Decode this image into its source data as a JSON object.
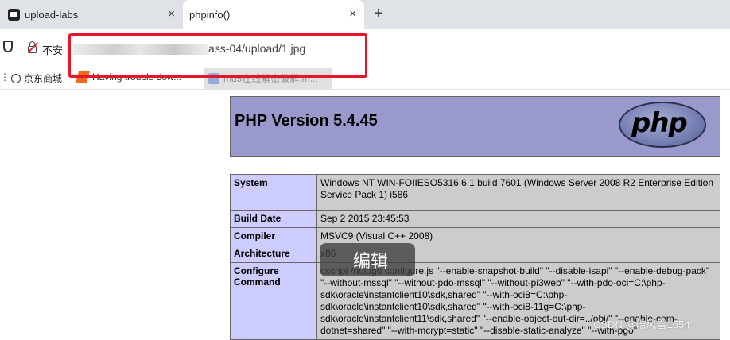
{
  "tabs": [
    {
      "label": "upload-labs",
      "icon": "page-icon",
      "close": "×"
    },
    {
      "label": "phpinfo()",
      "close": "×"
    }
  ],
  "new_tab": "+",
  "address_bar": {
    "security_label": "不安",
    "url_visible": "ass-04/upload/1.jpg"
  },
  "bookmarks": [
    {
      "label": "京东商城",
      "icon": "globe-icon"
    },
    {
      "label": "Having trouble dow...",
      "icon": "orange-favicon"
    },
    {
      "label": "md5在线解密破解,m...",
      "icon": "grid-favicon"
    }
  ],
  "bookmarks_overflow": "⋮",
  "php": {
    "version_title": "PHP Version 5.4.45",
    "logo_text": "php",
    "rows": [
      {
        "key": "System",
        "value": "Windows NT WIN-FOIIESO5316 6.1 build 7601 (Windows Server 2008 R2 Enterprise Edition Service Pack 1) i586"
      },
      {
        "key": "Build Date",
        "value": "Sep 2 2015 23:45:53"
      },
      {
        "key": "Compiler",
        "value": "MSVC9 (Visual C++ 2008)"
      },
      {
        "key": "Architecture",
        "value": "x86"
      },
      {
        "key": "Configure Command",
        "value": "cscript /nologo configure.js \"--enable-snapshot-build\" \"--disable-isapi\" \"--enable-debug-pack\" \"--without-mssql\" \"--without-pdo-mssql\" \"--without-pi3web\" \"--with-pdo-oci=C:\\php-sdk\\oracle\\instantclient10\\sdk,shared\" \"--with-oci8=C:\\php-sdk\\oracle\\instantclient10\\sdk,shared\" \"--with-oci8-11g=C:\\php-sdk\\oracle\\instantclient11\\sdk,shared\" \"--enable-object-out-dir=../obj/\" \"--enable-com-dotnet=shared\" \"--with-mcrypt=static\" \"--disable-static-analyze\" \"--with-pgo\""
      }
    ]
  },
  "edit_tooltip": "编辑",
  "watermark": "CSDN @皓风雪1554",
  "colors": {
    "highlight_box": "#e8152a",
    "php_header": "#9999cc",
    "key_cell": "#ccccff",
    "value_cell": "#cccccc"
  }
}
